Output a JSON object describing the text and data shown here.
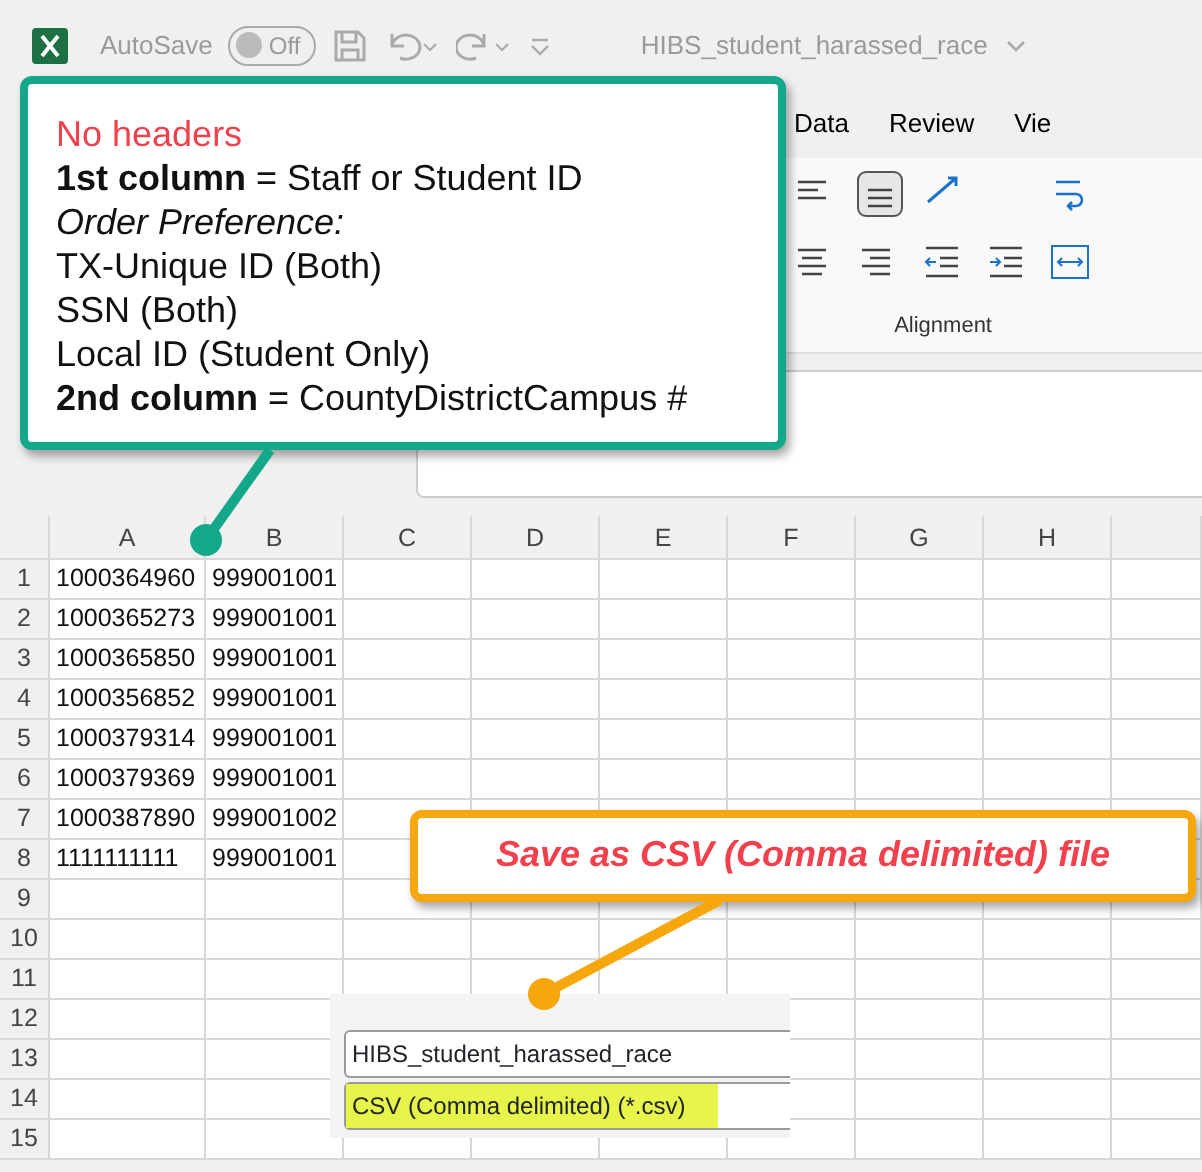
{
  "titlebar": {
    "autosave_label": "AutoSave",
    "autosave": {
      "on": false,
      "label": "Off"
    },
    "filename": "HIBS_student_harassed_race"
  },
  "ribbon": {
    "tabs": [
      {
        "label": "Data",
        "selected": false
      },
      {
        "label": "Review",
        "selected": false
      },
      {
        "label": "Vie",
        "selected": false
      }
    ],
    "group_label": "Alignment"
  },
  "sheet": {
    "columns": [
      "A",
      "B",
      "C",
      "D",
      "E",
      "F",
      "G",
      "H"
    ],
    "rows": [
      {
        "number": "1",
        "cells": [
          "1000364960",
          "999001001"
        ]
      },
      {
        "number": "2",
        "cells": [
          "1000365273",
          "999001001"
        ]
      },
      {
        "number": "3",
        "cells": [
          "1000365850",
          "999001001"
        ]
      },
      {
        "number": "4",
        "cells": [
          "1000356852",
          "999001001"
        ]
      },
      {
        "number": "5",
        "cells": [
          "1000379314",
          "999001001"
        ]
      },
      {
        "number": "6",
        "cells": [
          "1000379369",
          "999001001"
        ]
      },
      {
        "number": "7",
        "cells": [
          "1000387890",
          "999001002"
        ]
      },
      {
        "number": "8",
        "cells": [
          "1111111111",
          "999001001"
        ]
      },
      {
        "number": "9"
      },
      {
        "number": "10"
      },
      {
        "number": "11"
      },
      {
        "number": "12"
      },
      {
        "number": "13"
      },
      {
        "number": "14"
      },
      {
        "number": "15"
      }
    ]
  },
  "save_dialog": {
    "file_name": "HIBS_student_harassed_race",
    "file_type": {
      "value": "CSV (Comma delimited) (*.csv)",
      "highlighted": true
    }
  },
  "callouts": [
    {
      "color": "#13a88a",
      "lines": [
        {
          "kind": "alert",
          "text": "No headers"
        },
        {
          "kind": "plain",
          "text": "**1st column** = Staff or Student ID"
        },
        {
          "kind": "italic",
          "text": "Order Preference:"
        },
        {
          "kind": "plain",
          "text": "TX-Unique ID (Both)"
        },
        {
          "kind": "plain",
          "text": "SSN (Both)"
        },
        {
          "kind": "plain",
          "text": "Local ID (Student Only)"
        },
        {
          "kind": "plain",
          "text": "**2nd column** = CountyDistrictCampus #"
        }
      ]
    },
    {
      "color": "#f5a70b",
      "lines": [
        {
          "kind": "alert-emphasis",
          "text": "Save as CSV (Comma delimited) file"
        }
      ]
    }
  ]
}
